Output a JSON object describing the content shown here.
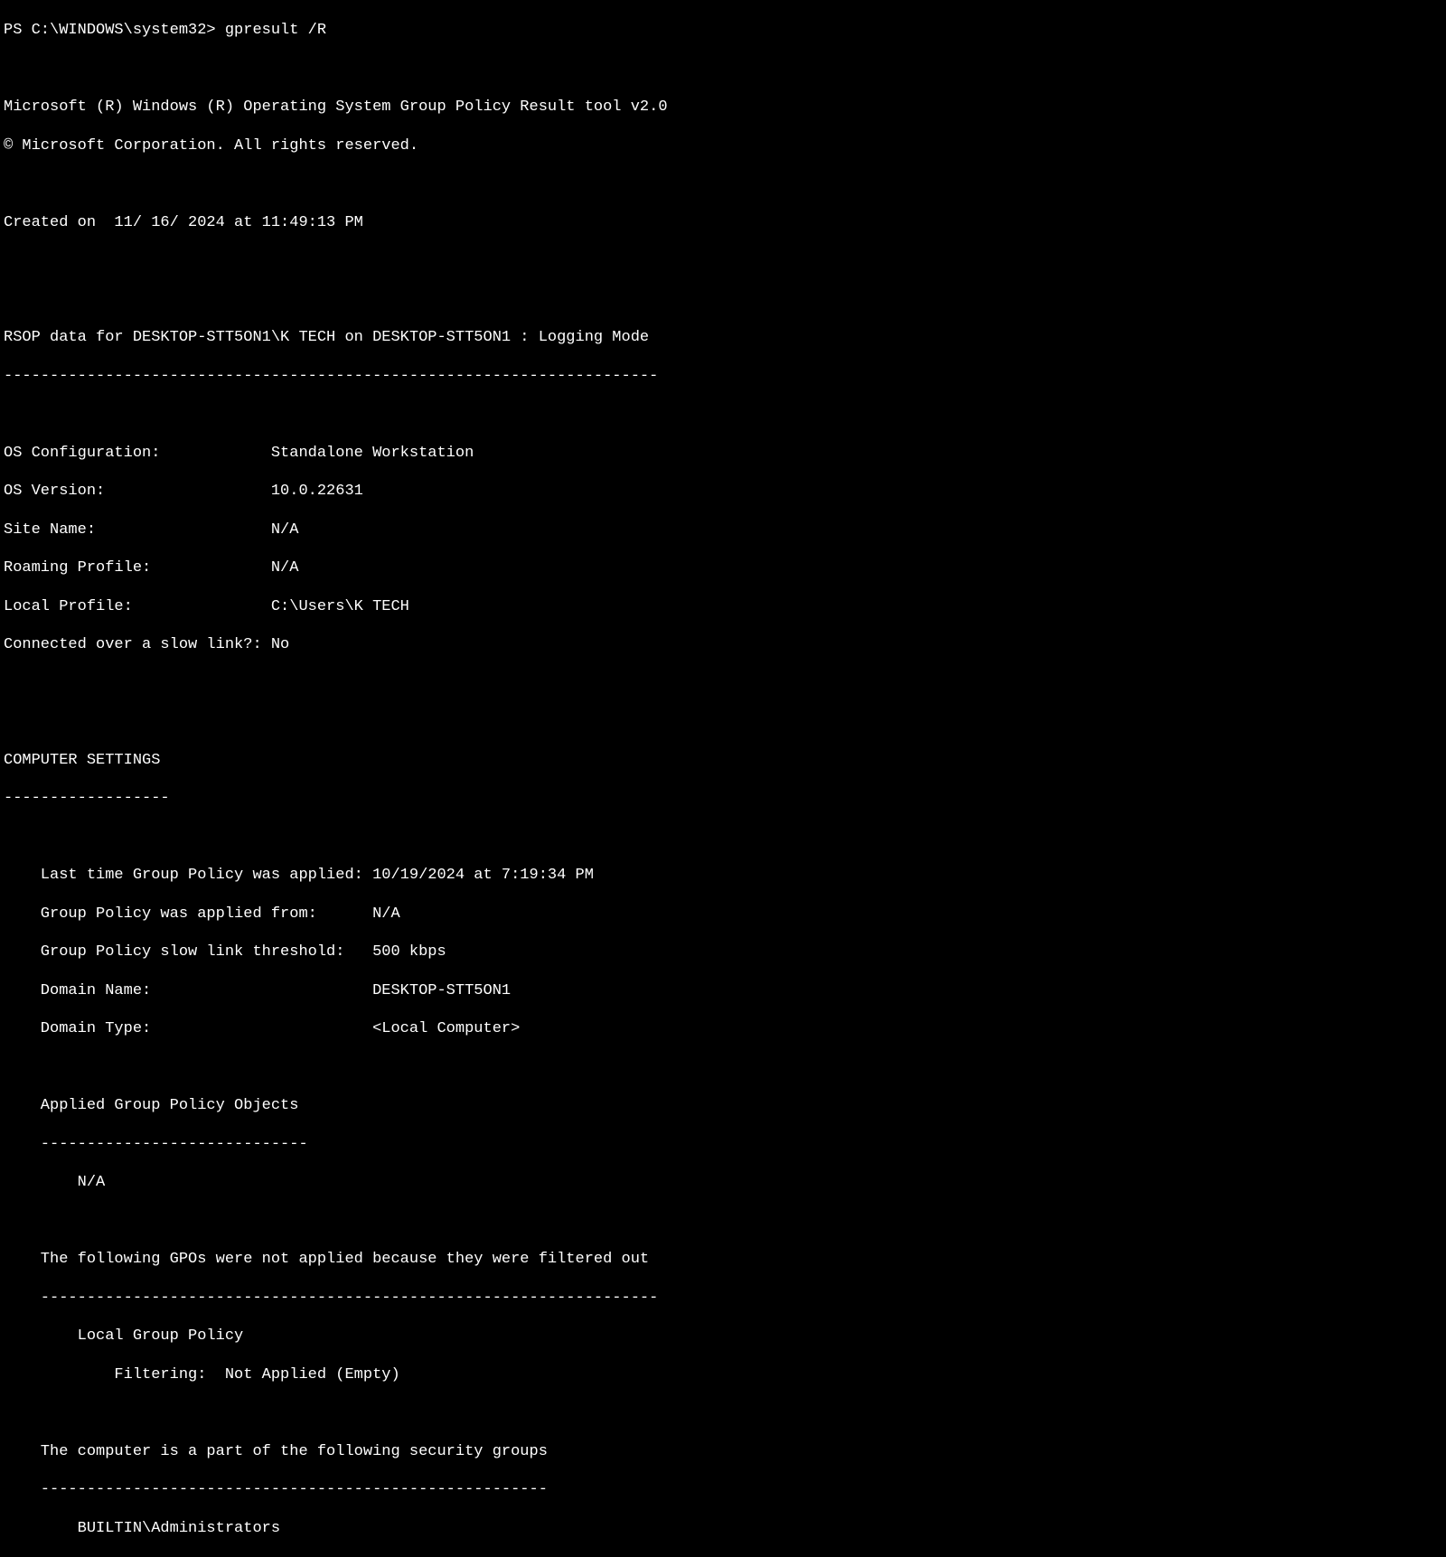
{
  "prompt": {
    "path": "PS C:\\WINDOWS\\system32> ",
    "command": "gpresult",
    "arg": " /R"
  },
  "header": {
    "tool_line": "Microsoft (R) Windows (R) Operating System Group Policy Result tool v2.0",
    "copyright": "© Microsoft Corporation. All rights reserved.",
    "created_on": "Created on  11/ 16/ 2024 at 11:49:13 PM"
  },
  "rsop": {
    "line": "RSOP data for DESKTOP-STT5ON1\\K TECH on DESKTOP-STT5ON1 : Logging Mode",
    "divider": "-----------------------------------------------------------------------"
  },
  "os_info": {
    "config": "OS Configuration:            Standalone Workstation",
    "version": "OS Version:                  10.0.22631",
    "site": "Site Name:                   N/A",
    "roaming": "Roaming Profile:             N/A",
    "local": "Local Profile:               C:\\Users\\K TECH",
    "slow_link": "Connected over a slow link?: No"
  },
  "computer_settings": {
    "title": "COMPUTER SETTINGS",
    "divider": "------------------"
  },
  "gp_details": {
    "last_applied": "    Last time Group Policy was applied: 10/19/2024 at 7:19:34 PM",
    "applied_from": "    Group Policy was applied from:      N/A",
    "threshold": "    Group Policy slow link threshold:   500 kbps",
    "domain_name": "    Domain Name:                        DESKTOP-STT5ON1",
    "domain_type": "    Domain Type:                        <Local Computer>"
  },
  "applied_gpo": {
    "title": "    Applied Group Policy Objects",
    "divider": "    -----------------------------",
    "value": "        N/A"
  },
  "filtered_gpo": {
    "title": "    The following GPOs were not applied because they were filtered out",
    "divider": "    -------------------------------------------------------------------",
    "name": "        Local Group Policy",
    "filter": "            Filtering:  Not Applied (Empty)"
  },
  "security_groups": {
    "title": "    The computer is a part of the following security groups",
    "divider": "    -------------------------------------------------------",
    "group1": "        BUILTIN\\Administrators"
  }
}
